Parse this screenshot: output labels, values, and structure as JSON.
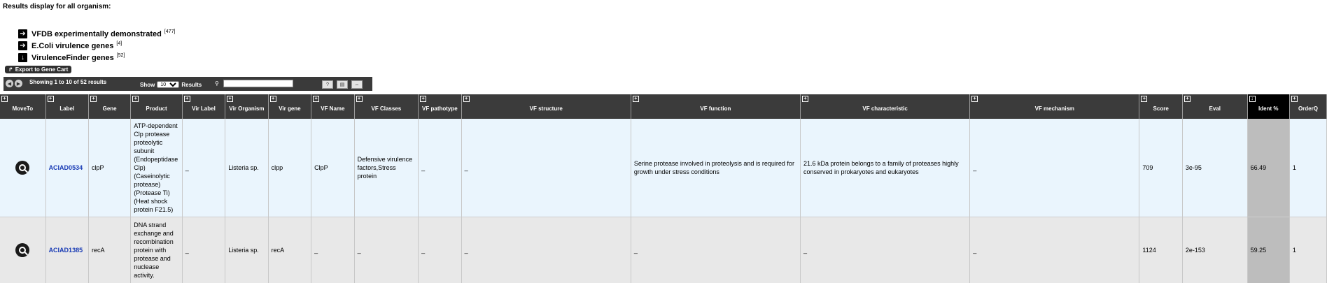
{
  "heading": "Results display for all organism:",
  "vf_sources": [
    {
      "label": "VFDB experimentally demonstrated",
      "count": "[477]",
      "icon": "arrow-right-icon",
      "glyph": "➔"
    },
    {
      "label": "E.Coli virulence genes",
      "count": "[4]",
      "icon": "arrow-right-icon",
      "glyph": "➔"
    },
    {
      "label": "VirulenceFinder genes",
      "count": "[52]",
      "icon": "arrow-down-icon",
      "glyph": "↓"
    }
  ],
  "export_label": "Export to Gene Cart",
  "toolbar": {
    "showing": "Showing 1 to 10 of 52 results",
    "show_label": "Show",
    "show_value": "10",
    "results_label": "Results",
    "search_placeholder": ""
  },
  "columns": [
    "MoveTo",
    "Label",
    "Gene",
    "Product",
    "Vir Label",
    "Vir Organism",
    "Vir gene",
    "VF Name",
    "VF Classes",
    "VF pathotype",
    "VF structure",
    "VF function",
    "VF characteristic",
    "VF mechanism",
    "Score",
    "Eval",
    "Ident %",
    "OrderQ"
  ],
  "sorted_column": "Ident %",
  "rows": [
    {
      "label": "ACIAD0534",
      "gene": "clpP",
      "product": "ATP-dependent Clp protease proteolytic subunit (Endopeptidase Clp) (Caseinolytic protease) (Protease Ti) (Heat shock protein F21.5)",
      "vir_label": "_",
      "vir_organism": "Listeria sp.",
      "vir_gene": "clpp",
      "vf_name": "ClpP",
      "vf_classes": "Defensive virulence factors,Stress protein",
      "vf_pathotype": "_",
      "vf_structure": "_",
      "vf_function": "Serine protease involved in proteolysis and is required for growth under stress conditions",
      "vf_characteristic": "21.6 kDa protein belongs to a family of proteases highly conserved in prokaryotes and eukaryotes",
      "vf_mechanism": "_",
      "score": "709",
      "eval": "3e-95",
      "ident": "66.49",
      "orderq": "1"
    },
    {
      "label": "ACIAD1385",
      "gene": "recA",
      "product": "DNA strand exchange and recombination protein with protease and nuclease activity.",
      "vir_label": "_",
      "vir_organism": "Listeria sp.",
      "vir_gene": "recA",
      "vf_name": "_",
      "vf_classes": "_",
      "vf_pathotype": "_",
      "vf_structure": "_",
      "vf_function": "_",
      "vf_characteristic": "_",
      "vf_mechanism": "_",
      "score": "1124",
      "eval": "2e-153",
      "ident": "59.25",
      "orderq": "1"
    }
  ]
}
